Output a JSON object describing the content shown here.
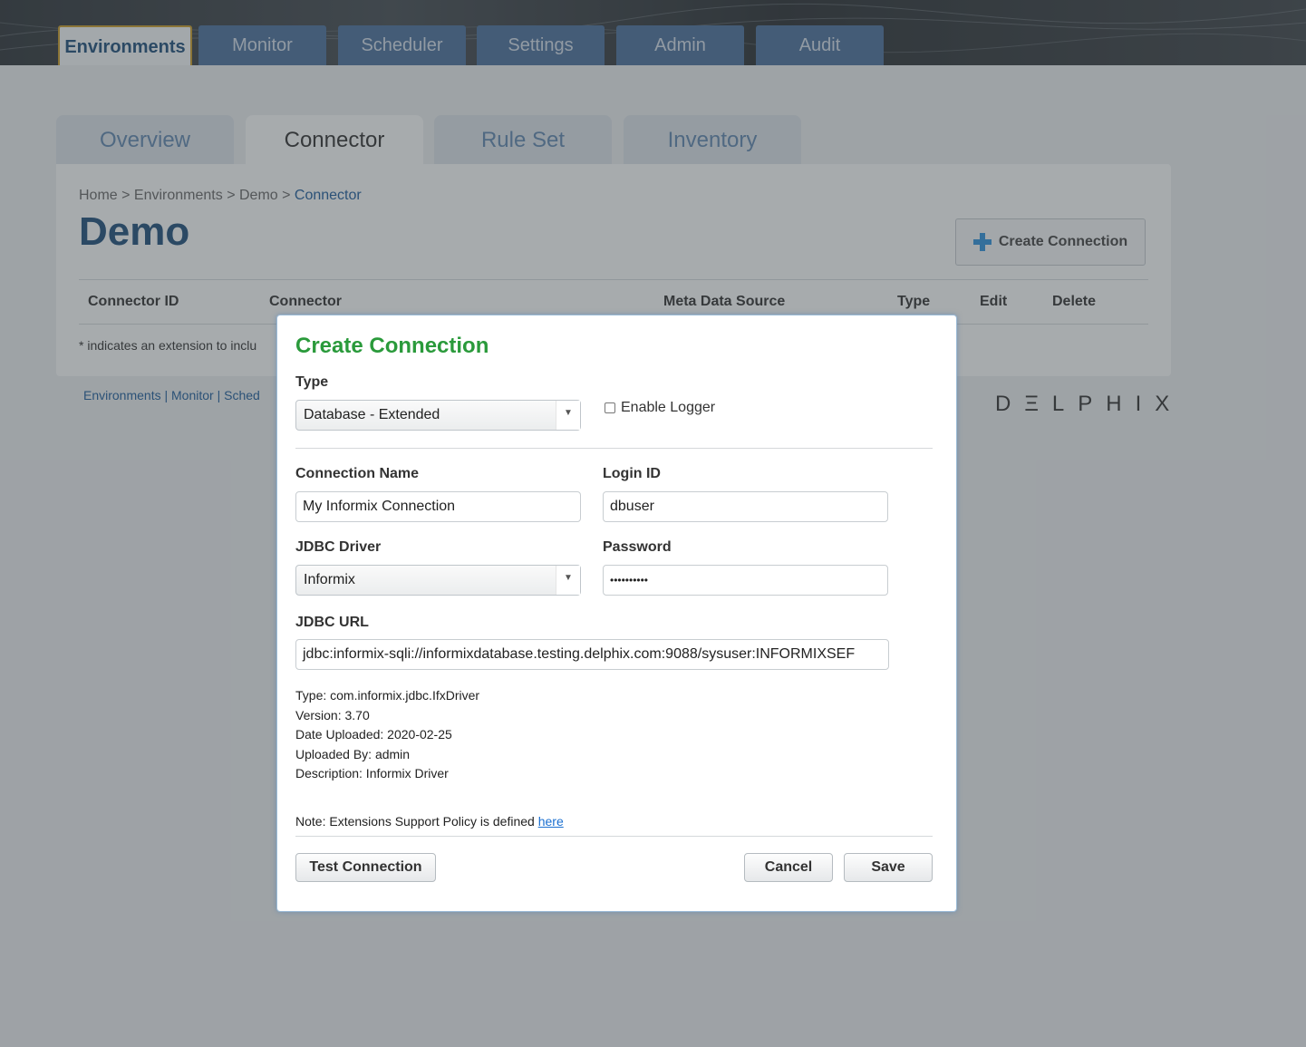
{
  "nav": {
    "tabs": [
      {
        "label": "Environments"
      },
      {
        "label": "Monitor"
      },
      {
        "label": "Scheduler"
      },
      {
        "label": "Settings"
      },
      {
        "label": "Admin"
      },
      {
        "label": "Audit"
      }
    ]
  },
  "subtabs": [
    {
      "label": "Overview"
    },
    {
      "label": "Connector"
    },
    {
      "label": "Rule Set"
    },
    {
      "label": "Inventory"
    }
  ],
  "breadcrumb": {
    "home": "Home",
    "sep1": " > ",
    "environments": "Environments",
    "sep2": " > ",
    "demo": "Demo",
    "sep3": " > ",
    "current": "Connector"
  },
  "page_title": "Demo",
  "create_connection_label": "Create Connection",
  "table": {
    "headers": [
      "Connector ID",
      "Connector",
      "Meta Data Source",
      "Type",
      "Edit",
      "Delete"
    ]
  },
  "extension_note": "* indicates an extension to inclu",
  "footer": {
    "links": "Environments | Monitor | Sched"
  },
  "brand": "DΞLPHIX",
  "modal": {
    "title": "Create Connection",
    "type_label": "Type",
    "type_value": "Database - Extended",
    "enable_logger_label": "Enable Logger",
    "connection_name_label": "Connection Name",
    "connection_name_value": "My Informix Connection",
    "login_id_label": "Login ID",
    "login_id_value": "dbuser",
    "jdbc_driver_label": "JDBC Driver",
    "jdbc_driver_value": "Informix",
    "password_label": "Password",
    "password_value": "••••••••••",
    "jdbc_url_label": "JDBC URL",
    "jdbc_url_value": "jdbc:informix-sqli://informixdatabase.testing.delphix.com:9088/sysuser:INFORMIXSEF",
    "driver_info": {
      "type": "Type: com.informix.jdbc.IfxDriver",
      "version": "Version: 3.70",
      "date_uploaded": "Date Uploaded: 2020-02-25",
      "uploaded_by": "Uploaded By: admin",
      "description": "Description: Informix Driver"
    },
    "policy_note": "Note: Extensions Support Policy is defined ",
    "policy_link": "here",
    "test_connection_label": "Test Connection",
    "cancel_label": "Cancel",
    "save_label": "Save"
  }
}
